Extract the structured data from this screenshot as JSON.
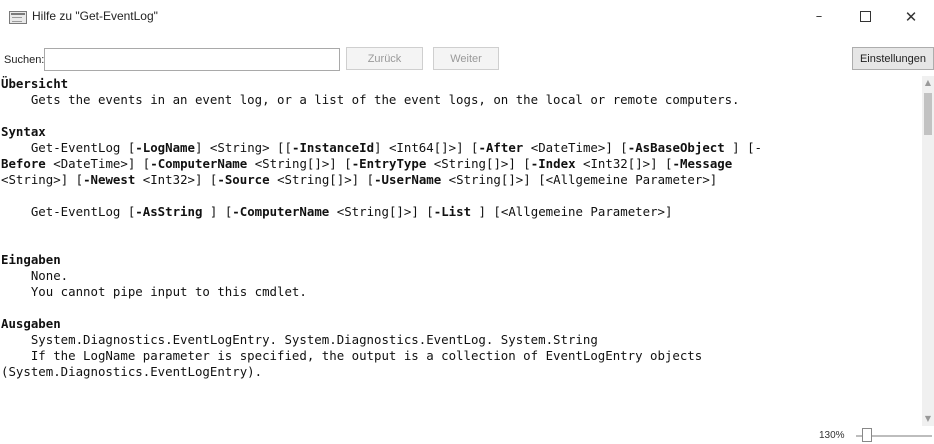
{
  "window": {
    "title": "Hilfe zu \"Get-EventLog\"",
    "minimize": "–",
    "close": "✕"
  },
  "search": {
    "label": "Suchen:",
    "value": "",
    "placeholder": ""
  },
  "toolbar": {
    "back_label": "Zurück",
    "forward_label": "Weiter",
    "settings_label": "Einstellungen"
  },
  "help": {
    "sections": {
      "overview": {
        "heading": "Übersicht",
        "text": "    Gets the events in an event log, or a list of the event logs, on the local or remote computers."
      },
      "syntax": {
        "heading": "Syntax",
        "cmd": "Get-EventLog",
        "p_logname": "-LogName",
        "t_string": "<String>",
        "p_instanceid": "-InstanceId",
        "t_int64arr": "<Int64[]>",
        "p_after": "-After",
        "t_datetime": "<DateTime>",
        "p_asbaseobject": "-AsBaseObject",
        "p_before": "Before",
        "p_computername": "-ComputerName",
        "t_stringarr": "<String[]>",
        "p_entrytype": "-EntryType",
        "p_index": "-Index",
        "t_int32arr": "<Int32[]>",
        "p_message": "-Message",
        "p_newest": "-Newest",
        "t_int32": "<Int32>",
        "p_source": "-Source",
        "p_username": "-UserName",
        "common": "<Allgemeine Parameter>",
        "p_asstring": "-AsString",
        "p_list": "-List"
      },
      "inputs": {
        "heading": "Eingaben",
        "line1": "    None.",
        "line2": "    You cannot pipe input to this cmdlet."
      },
      "outputs": {
        "heading": "Ausgaben",
        "line1": "    System.Diagnostics.EventLogEntry. System.Diagnostics.EventLog. System.String",
        "line2": "    If the LogName parameter is specified, the output is a collection of EventLogEntry objects",
        "line3": "(System.Diagnostics.EventLogEntry)."
      }
    }
  },
  "status": {
    "zoom": "130%",
    "zoom_slider_fraction": 0.15
  }
}
